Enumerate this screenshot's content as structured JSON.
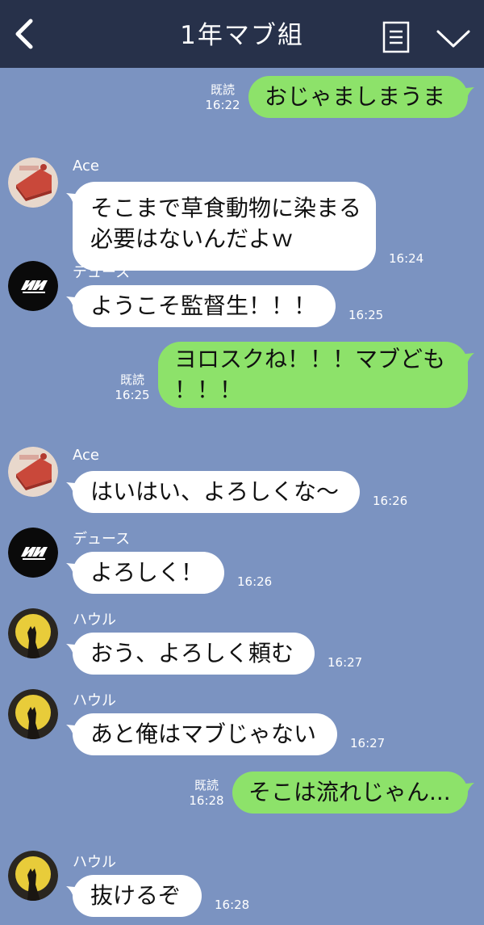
{
  "header": {
    "title": "1年マブ組"
  },
  "icons": {
    "back": "chevron-left-icon",
    "menu": "note-icon",
    "collapse": "chevron-down-icon"
  },
  "colors": {
    "header_bg": "#27314a",
    "chat_bg": "#7b93c1",
    "outgoing": "#8de26a",
    "incoming": "#ffffff"
  },
  "messages": [
    {
      "direction": "out",
      "read": "既読",
      "time": "16:22",
      "lines": [
        "おじゃましまうま"
      ]
    },
    {
      "direction": "in",
      "sender": "Ace",
      "time": "16:24",
      "lines": [
        "そこまで草食動物に染まる",
        "必要はないんだよｗ"
      ]
    },
    {
      "direction": "in",
      "sender": "デュース",
      "time": "16:25",
      "lines": [
        "ようこそ監督生！！！"
      ]
    },
    {
      "direction": "out",
      "read": "既読",
      "time": "16:25",
      "lines": [
        "ヨロスクね！！！マブども",
        "！！！"
      ]
    },
    {
      "direction": "in",
      "sender": "Ace",
      "time": "16:26",
      "lines": [
        "はいはい、よろしくな〜"
      ]
    },
    {
      "direction": "in",
      "sender": "デュース",
      "time": "16:26",
      "lines": [
        "よろしく！"
      ]
    },
    {
      "direction": "in",
      "sender": "ハウル",
      "time": "16:27",
      "lines": [
        "おう、よろしく頼む"
      ]
    },
    {
      "direction": "in",
      "sender": "ハウル",
      "time": "16:27",
      "lines": [
        "あと俺はマブじゃない"
      ]
    },
    {
      "direction": "out",
      "read": "既読",
      "time": "16:28",
      "lines": [
        "そこは流れじゃん..."
      ]
    },
    {
      "direction": "in",
      "sender": "ハウル",
      "time": "16:28",
      "lines": [
        "抜けるぞ"
      ]
    }
  ]
}
